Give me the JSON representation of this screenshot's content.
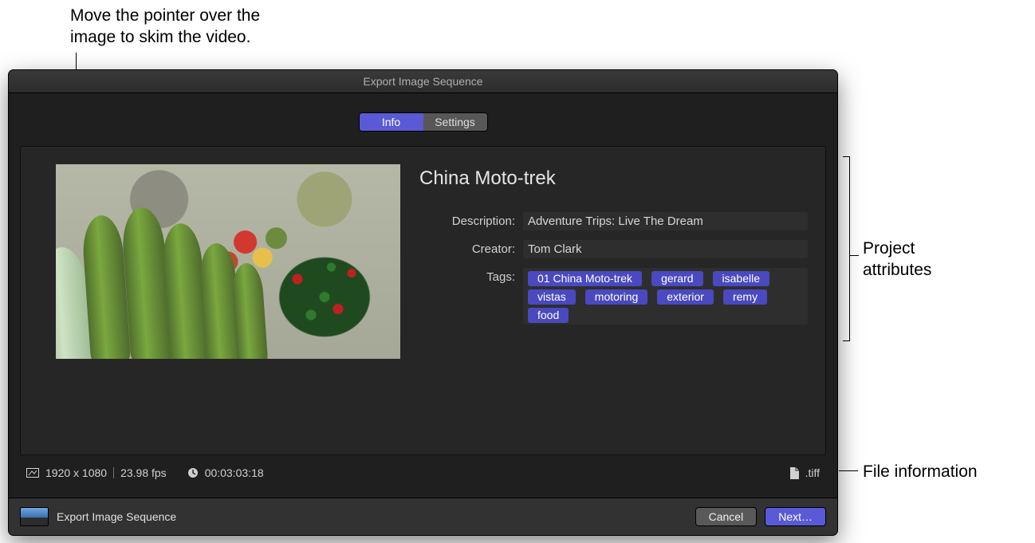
{
  "annotations": {
    "skim": "Move the pointer over the\nimage to skim the video.",
    "project_attrs": "Project\nattributes",
    "file_info": "File information"
  },
  "window": {
    "title": "Export Image Sequence"
  },
  "tabs": {
    "info": "Info",
    "settings": "Settings"
  },
  "project": {
    "title": "China Moto-trek",
    "fields": {
      "description_label": "Description:",
      "description_value": "Adventure Trips: Live The Dream",
      "creator_label": "Creator:",
      "creator_value": "Tom Clark",
      "tags_label": "Tags:"
    },
    "tags": [
      "01 China Moto-trek",
      "gerard",
      "isabelle",
      "vistas",
      "motoring",
      "exterior",
      "remy",
      "food"
    ]
  },
  "status": {
    "resolution": "1920 x 1080",
    "fps": "23.98 fps",
    "duration": "00:03:03:18",
    "extension": ".tiff"
  },
  "footer": {
    "label": "Export Image Sequence",
    "cancel": "Cancel",
    "next": "Next…"
  }
}
